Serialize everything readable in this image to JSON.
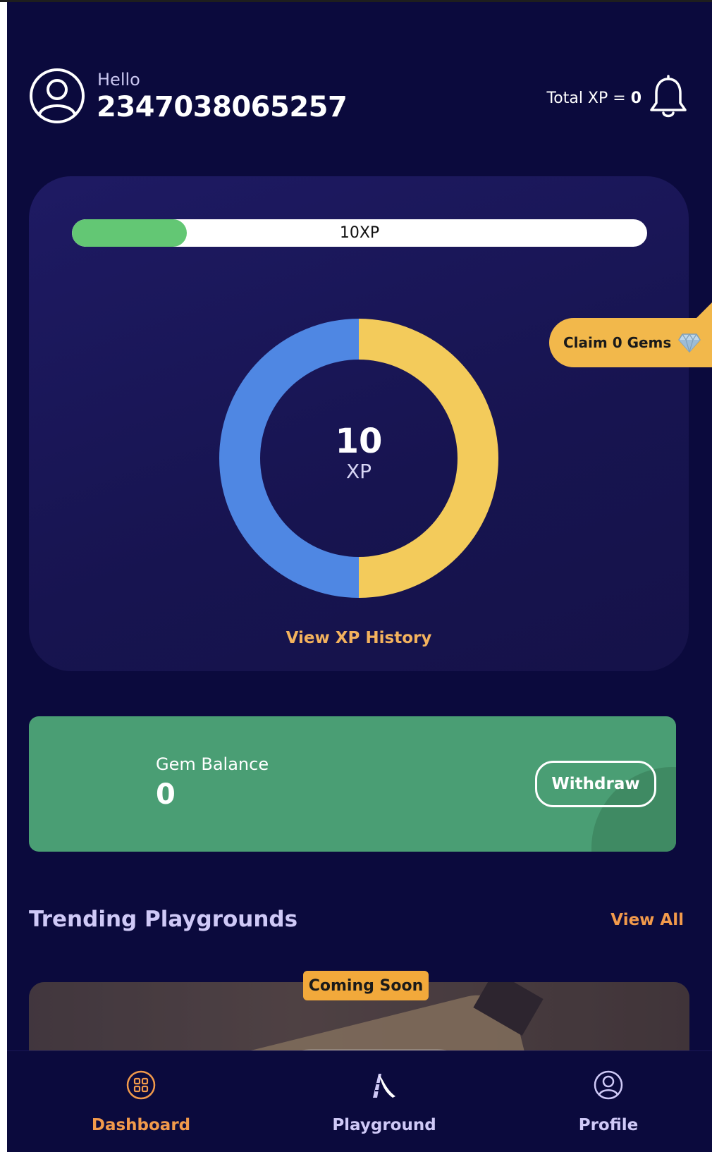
{
  "header": {
    "greeting": "Hello",
    "username": "2347038065257",
    "total_xp_label": "Total XP =",
    "total_xp_value": "0"
  },
  "xp_card": {
    "progress_label": "10XP",
    "progress_fraction": 0.2,
    "donut_value": "10",
    "donut_unit": "XP",
    "donut_segments": [
      {
        "fraction": 0.5,
        "color": "#f3cb5b"
      },
      {
        "fraction": 0.5,
        "color": "#4f87e3"
      }
    ],
    "view_history_label": "View XP History"
  },
  "claim": {
    "label": "Claim 0 Gems",
    "icon": "gem-icon"
  },
  "gem_balance": {
    "label": "Gem Balance",
    "value": "0",
    "withdraw_label": "Withdraw"
  },
  "trending": {
    "title": "Trending Playgrounds",
    "view_all_label": "View All",
    "badge": "Coming Soon"
  },
  "nav": {
    "items": [
      {
        "label": "Dashboard",
        "icon": "grid-icon",
        "active": true
      },
      {
        "label": "Playground",
        "icon": "slide-icon",
        "active": false
      },
      {
        "label": "Profile",
        "icon": "user-icon",
        "active": false
      }
    ]
  },
  "colors": {
    "background": "#0b0a3d",
    "accent_orange": "#f29a4b",
    "progress_green": "#63c774",
    "gem_card": "#4a9e74",
    "nav_inactive": "#cfc9f7"
  }
}
